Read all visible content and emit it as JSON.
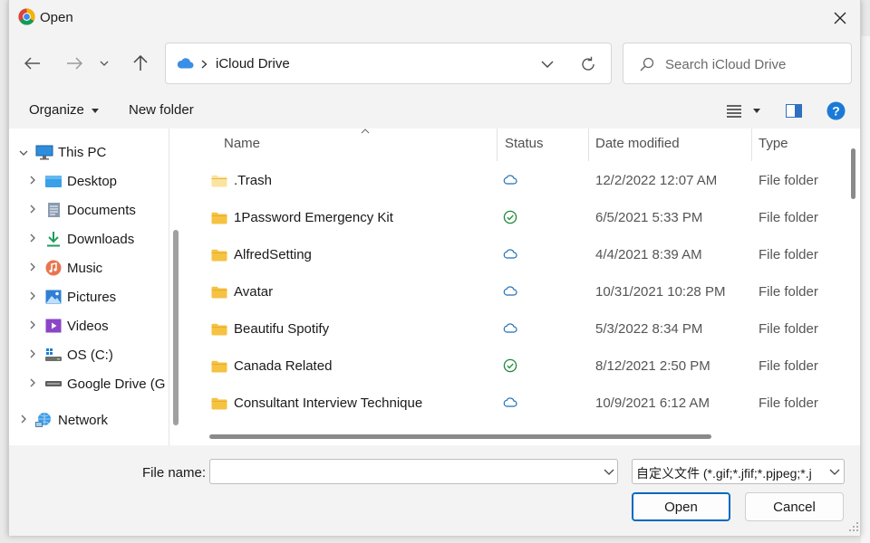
{
  "window": {
    "title": "Open"
  },
  "nav": {
    "address_path": "iCloud Drive",
    "search_placeholder": "Search iCloud Drive"
  },
  "toolbar": {
    "organize": "Organize",
    "new_folder": "New folder"
  },
  "tree": {
    "items": [
      {
        "label": "This PC",
        "icon": "monitor-icon"
      },
      {
        "label": "Desktop",
        "icon": "desktop-icon"
      },
      {
        "label": "Documents",
        "icon": "documents-icon"
      },
      {
        "label": "Downloads",
        "icon": "download-icon"
      },
      {
        "label": "Music",
        "icon": "music-icon"
      },
      {
        "label": "Pictures",
        "icon": "pictures-icon"
      },
      {
        "label": "Videos",
        "icon": "videos-icon"
      },
      {
        "label": "OS (C:)",
        "icon": "drive-icon"
      },
      {
        "label": "Google Drive (G",
        "icon": "drive-icon"
      },
      {
        "label": "Network",
        "icon": "network-icon"
      }
    ]
  },
  "columns": {
    "name": "Name",
    "status": "Status",
    "date": "Date modified",
    "type": "Type"
  },
  "files": [
    {
      "name": ".Trash",
      "status": "cloud",
      "date": "12/2/2022 12:07 AM",
      "type": "File folder"
    },
    {
      "name": "1Password Emergency Kit",
      "status": "synced",
      "date": "6/5/2021 5:33 PM",
      "type": "File folder"
    },
    {
      "name": "AlfredSetting",
      "status": "cloud",
      "date": "4/4/2021 8:39 AM",
      "type": "File folder"
    },
    {
      "name": "Avatar",
      "status": "cloud",
      "date": "10/31/2021 10:28 PM",
      "type": "File folder"
    },
    {
      "name": "Beautifu Spotify",
      "status": "cloud",
      "date": "5/3/2022 8:34 PM",
      "type": "File folder"
    },
    {
      "name": "Canada Related",
      "status": "synced",
      "date": "8/12/2021 2:50 PM",
      "type": "File folder"
    },
    {
      "name": "Consultant Interview Technique",
      "status": "cloud",
      "date": "10/9/2021 6:12 AM",
      "type": "File folder"
    }
  ],
  "footer": {
    "file_name_label": "File name:",
    "file_name_value": "",
    "filter_text": "自定义文件 (*.gif;*.jfif;*.pjpeg;*.j",
    "open_label": "Open",
    "cancel_label": "Cancel"
  },
  "colors": {
    "accent": "#0067c0",
    "folder": "#f5c242",
    "cloud": "#1f6fb5",
    "synced": "#1d8a3a"
  }
}
